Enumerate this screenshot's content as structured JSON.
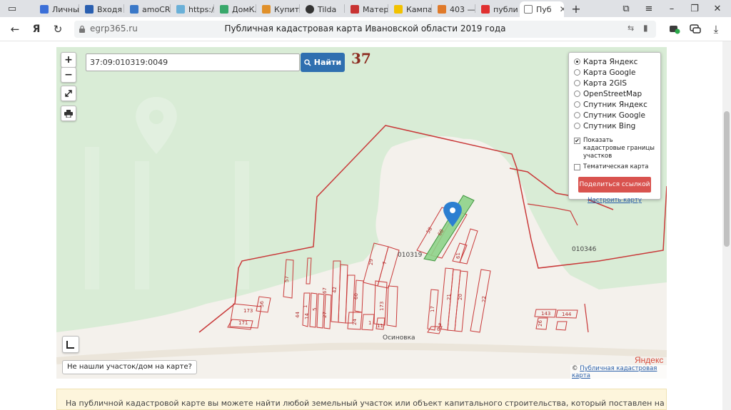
{
  "browser": {
    "tabs": [
      {
        "label": "Личны",
        "color": "#3b6fd8"
      },
      {
        "label": "Входя",
        "color": "#2a5fb0"
      },
      {
        "label": "amoCR",
        "color": "#3a78c8"
      },
      {
        "label": "https:/",
        "color": "#6ab0d8"
      },
      {
        "label": "ДомКл",
        "color": "#39a86b"
      },
      {
        "label": "Купить",
        "color": "#e0902a"
      },
      {
        "label": "Tilda",
        "color": "#333333"
      },
      {
        "label": "Матер",
        "color": "#c83232"
      },
      {
        "label": "Кампа",
        "color": "#f2c200"
      },
      {
        "label": "403 —",
        "color": "#e07a2a"
      },
      {
        "label": "публи",
        "color": "#e03030"
      },
      {
        "label": "Пуб",
        "color": "#777777"
      }
    ],
    "address_domain": "egrp365.ru",
    "page_title": "Публичная кадастровая карта Ивановской области 2019 года"
  },
  "map": {
    "search_value": "37:09:010319:0049",
    "find_label": "Найти",
    "region_number": "37",
    "zoom_in": "+",
    "zoom_out": "−",
    "layers": {
      "options": [
        "Карта Яндекс",
        "Карта Google",
        "Карта 2GIS",
        "OpenStreetMap",
        "Спутник Яндекс",
        "Спутник Google",
        "Спутник Bing"
      ],
      "selected": "Карта Яндекс",
      "show_boundaries_label": "Показать кадастровые границы участков",
      "show_boundaries_checked": true,
      "thematic_label": "Тематическая карта",
      "thematic_checked": false,
      "share_label": "Поделиться ссылкой",
      "configure_label": "Настроить карту"
    },
    "not_found_label": "Не нашли участок/дом на карте?",
    "yandex_logo": "Яндекс",
    "copyright_symbol": "©",
    "copyright_link": "Публичная кадастровая карта",
    "village": "Осиновка",
    "quarters": [
      "010319",
      "010346"
    ],
    "plots": [
      "58",
      "60",
      "29",
      "7",
      "61",
      "57",
      "56",
      "42",
      "60",
      "67",
      "1",
      "5",
      "27",
      "14",
      "44",
      "173",
      "24",
      "1",
      "11",
      "173",
      "171",
      "17",
      "9",
      "21",
      "20",
      "22",
      "143",
      "144",
      "26",
      "6"
    ]
  },
  "info_text": "На публичной кадастровой карте вы можете найти любой земельный участок или объект капитального строительства, который поставлен на кадастровый учёт в"
}
